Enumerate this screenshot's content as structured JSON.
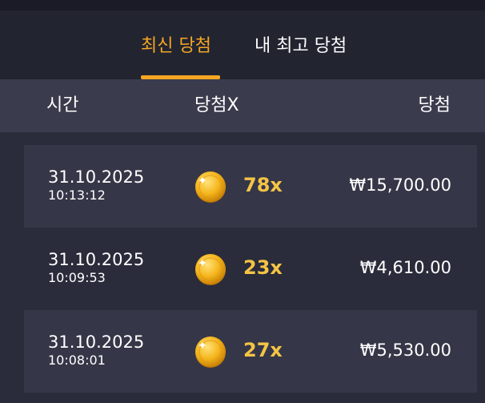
{
  "tabs": {
    "latest": "최신 당첨",
    "best": "내 최고 당첨"
  },
  "header": {
    "time": "시간",
    "multiplier": "당첨X",
    "win": "당첨"
  },
  "rows": [
    {
      "date": "31.10.2025",
      "time": "10:13:12",
      "multiplier": "78x",
      "amount": "₩15,700.00"
    },
    {
      "date": "31.10.2025",
      "time": "10:09:53",
      "multiplier": "23x",
      "amount": "₩4,610.00"
    },
    {
      "date": "31.10.2025",
      "time": "10:08:01",
      "multiplier": "27x",
      "amount": "₩5,530.00"
    }
  ],
  "colors": {
    "accent": "#f5a623",
    "multiplier": "#f5c445",
    "background": "#2a2c3b",
    "row": "#353748",
    "header": "#3a3c4d"
  },
  "icons": {
    "coin": "gold-coin-icon"
  }
}
